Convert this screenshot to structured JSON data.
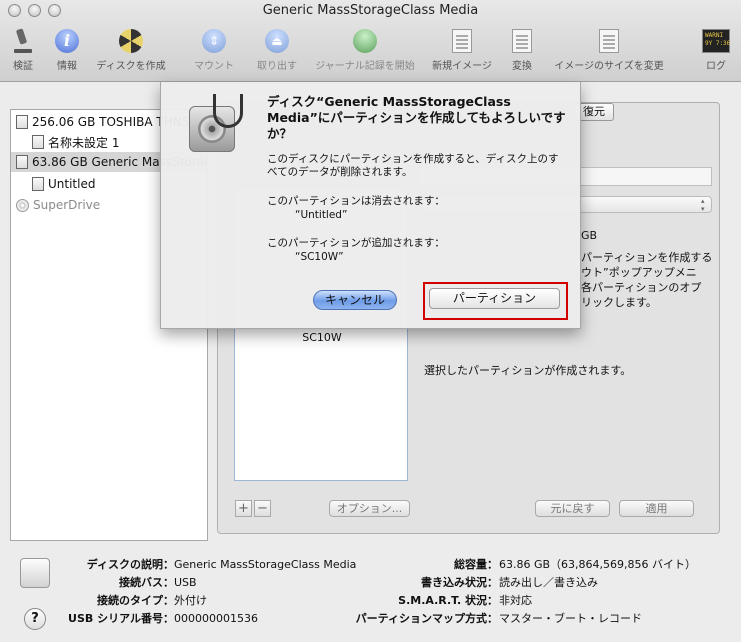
{
  "window": {
    "title": "Generic MassStorageClass Media"
  },
  "toolbar": {
    "items": [
      {
        "label": "検証",
        "icon": "microscope-icon"
      },
      {
        "label": "情報",
        "icon": "info-icon"
      },
      {
        "label": "ディスクを作成",
        "icon": "burn-disc-icon"
      },
      {
        "label": "マウント",
        "icon": "mount-icon"
      },
      {
        "label": "取り出す",
        "icon": "eject-icon"
      },
      {
        "label": "ジャーナル記録を開始",
        "icon": "journal-icon"
      },
      {
        "label": "新規イメージ",
        "icon": "new-image-icon"
      },
      {
        "label": "変換",
        "icon": "convert-icon"
      },
      {
        "label": "イメージのサイズを変更",
        "icon": "resize-image-icon"
      },
      {
        "label": "ログ",
        "icon": "log-icon",
        "badge": "WARNI\n9Y 7:36"
      }
    ]
  },
  "sidebar": {
    "items": [
      {
        "label": "256.06 GB TOSHIBA THNSNS256GMCP"
      },
      {
        "label": "名称未設定 1"
      },
      {
        "label": "63.86 GB Generic MassStorageClass Media"
      },
      {
        "label": "Untitled"
      },
      {
        "label": "SuperDrive"
      }
    ]
  },
  "tabs": {
    "restore": "復元"
  },
  "panel": {
    "partition_name": "SC10W",
    "size_unit": "GB",
    "description": "パーティションを作成する\nウト”ポップアップメニ\n各パーティションのオプ\nリックします。",
    "status_text": "選択したパーティションが作成されます。",
    "options_button": "オプション...",
    "revert_button": "元に戻す",
    "apply_button": "適用",
    "add_symbol": "+",
    "remove_symbol": "−"
  },
  "dialog": {
    "title": "ディスク“Generic MassStorageClass Media”にパーティションを作成してもよろしいですか？",
    "message": "このディスクにパーティションを作成すると、ディスク上のすべてのデータが削除されます。",
    "erase_label": "このパーティションは消去されます：",
    "erase_value": "“Untitled”",
    "add_label": "このパーティションが追加されます：",
    "add_value": "“SC10W”",
    "cancel_button": "キャンセル",
    "partition_button": "パーティション"
  },
  "info": {
    "left": [
      {
        "label": "ディスクの説明：",
        "value": "Generic MassStorageClass Media"
      },
      {
        "label": "接続バス：",
        "value": "USB"
      },
      {
        "label": "接続のタイプ：",
        "value": "外付け"
      },
      {
        "label": "USB シリアル番号：",
        "value": "000000001536"
      }
    ],
    "right": [
      {
        "label": "総容量：",
        "value": "63.86 GB（63,864,569,856 バイト）"
      },
      {
        "label": "書き込み状況：",
        "value": "読み出し／書き込み"
      },
      {
        "label": "S.M.A.R.T. 状況：",
        "value": "非対応"
      },
      {
        "label": "パーティションマップ方式：",
        "value": "マスター・ブート・レコード"
      }
    ]
  },
  "colors": {
    "accent": "#6e9ce8",
    "highlight": "#d30000"
  }
}
